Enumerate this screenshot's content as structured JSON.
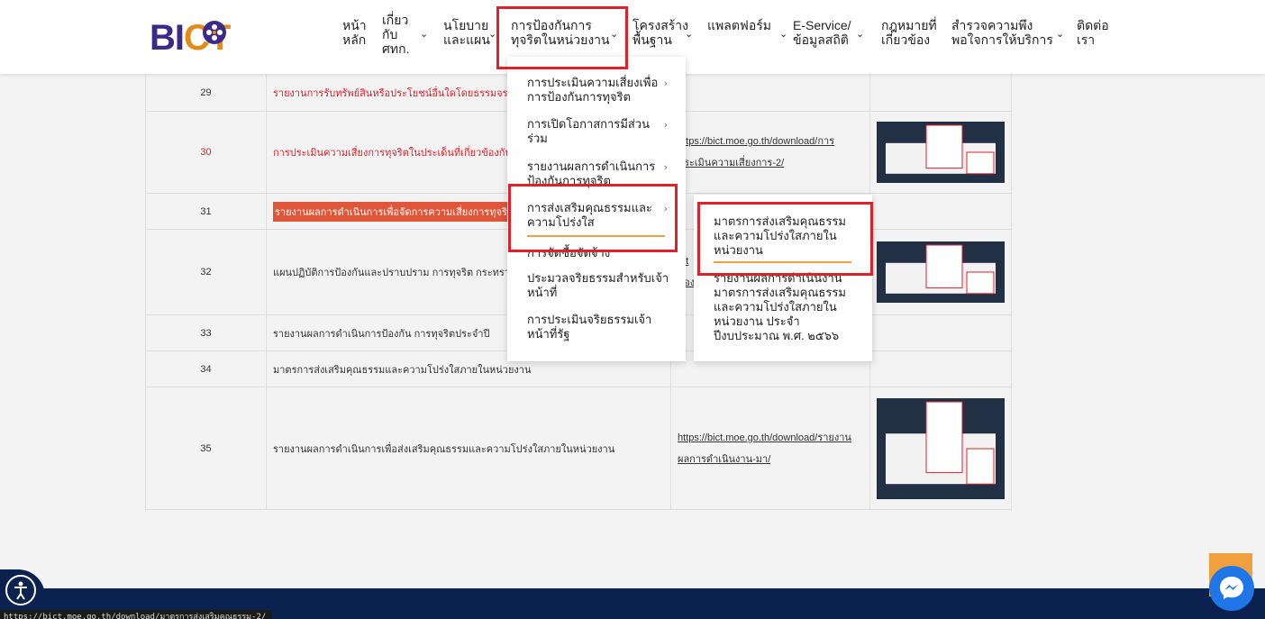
{
  "logo": {
    "text_main": "BI",
    "text_accent": "CT"
  },
  "nav": [
    {
      "label": "หน้า\nหลัก",
      "has_chevron": false
    },
    {
      "label": "เกี่ยว\nกับ\nศทก.",
      "has_chevron": true
    },
    {
      "label": "นโยบาย\nและแผน",
      "has_chevron": true
    },
    {
      "label": "การป้องกันการ\nทุจริตในหน่วยงาน",
      "has_chevron": true
    },
    {
      "label": "โครงสร้าง\nพื้นฐาน",
      "has_chevron": true
    },
    {
      "label": "แพลตฟอร์ม",
      "has_chevron": true
    },
    {
      "label": "E-Service/\nข้อมูลสถิติ",
      "has_chevron": true
    },
    {
      "label": "กฎหมายที่\nเกี่ยวข้อง",
      "has_chevron": false
    },
    {
      "label": "สำรวจความพึง\nพอใจการให้บริการ",
      "has_chevron": true
    },
    {
      "label": "ติดต่อ\nเรา",
      "has_chevron": false
    }
  ],
  "dropdown": [
    {
      "label": "การประเมินความเสี่ยงเพื่อ\nการป้องกันการทุจริต",
      "has_chevron": true
    },
    {
      "label": "การเปิดโอกาสการมีส่วน\nร่วม",
      "has_chevron": true
    },
    {
      "label": "รายงานผลการดำเนินการ\nป้องกันการทุจริต",
      "has_chevron": true
    },
    {
      "label": "การส่งเสริมคุณธรรมและ\nความโปร่งใส",
      "has_chevron": true
    },
    {
      "label": "การจัดซื้อจัดจ้าง",
      "has_chevron": false
    },
    {
      "label": "ประมวลจริยธรรมสำหรับเจ้า\nหน้าที่",
      "has_chevron": false
    },
    {
      "label": "การประเมินจริยธรรมเจ้า\nหน้าที่รัฐ",
      "has_chevron": false
    }
  ],
  "submenu": [
    {
      "label": "มาตรการส่งเสริมคุณธรรม\nและความโปร่งใสภายใน\nหน่วยงาน"
    },
    {
      "label": "รายงานผลการดำเนินงาน\nมาตรการส่งเสริมคุณธรรม\nและความโปร่งใสภายใน\nหน่วยงาน ประจำ\nปีงบประมาณ พ.ศ. ๒๕๖๖"
    }
  ],
  "table_rows": [
    {
      "num": "29",
      "title": "รายงานการรับทรัพย์สินหรือประโยชน์อื่นใดโดยธรรมจรรยา",
      "link1": "",
      "link2": "",
      "title_red": true,
      "num_red": false,
      "highlight": false,
      "thumb": false
    },
    {
      "num": "30",
      "title": "การประเมินความเสี่ยงการทุจริตในประเด็นที่เกี่ยวข้องกับสินบน",
      "link1": "https://bict.moe.go.th/download/การ",
      "link2": "ประเมินความเสี่ยงการ-2/",
      "title_red": true,
      "num_red": true,
      "highlight": false,
      "thumb": true
    },
    {
      "num": "31",
      "title": "รายงานผลการดำเนินการเพื่อจัดการความเสี่ยงการทุจริตและ",
      "link1": "",
      "link2": "",
      "title_red": false,
      "num_red": false,
      "highlight": true,
      "thumb": false
    },
    {
      "num": "32",
      "title": "แผนปฏิบัติการป้องกันและปราบปราม การทุจริต กระทรวงศึกษาธิการ",
      "link1": "htt",
      "link2": "ดอง",
      "title_red": false,
      "num_red": false,
      "highlight": false,
      "thumb": true
    },
    {
      "num": "33",
      "title": "รายงานผลการดำเนินการป้องกัน การทุจริตประจำปี",
      "link1": "",
      "link2": "",
      "title_red": false,
      "num_red": false,
      "highlight": false,
      "thumb": false
    },
    {
      "num": "34",
      "title": "มาตรการส่งเสริมคุณธรรมและความโปร่งใสภายในหน่วยงาน",
      "link1": "",
      "link2": "",
      "title_red": false,
      "num_red": false,
      "highlight": false,
      "thumb": false
    },
    {
      "num": "35",
      "title": "รายงานผลการดำเนินการเพื่อส่งเสริมคุณธรรมและความโปร่งใสภายในหน่วยงาน",
      "link1": "https://bict.moe.go.th/download/รายงาน",
      "link2": "ผลการดำเนินงาน-มา/",
      "title_red": false,
      "num_red": false,
      "highlight": false,
      "thumb": true
    }
  ],
  "status_url": "https://bict.moe.go.th/download/มาตรการส่งเสริมคุณธรรม-2/",
  "colors": {
    "brand_purple": "#3b2a8c",
    "accent_orange": "#f0a03c",
    "highlight_red": "#e0202a",
    "footer_navy": "#0b2150"
  },
  "icons": [
    "accessibility-icon",
    "messenger-icon",
    "chevron-down-icon",
    "chevron-right-icon"
  ]
}
